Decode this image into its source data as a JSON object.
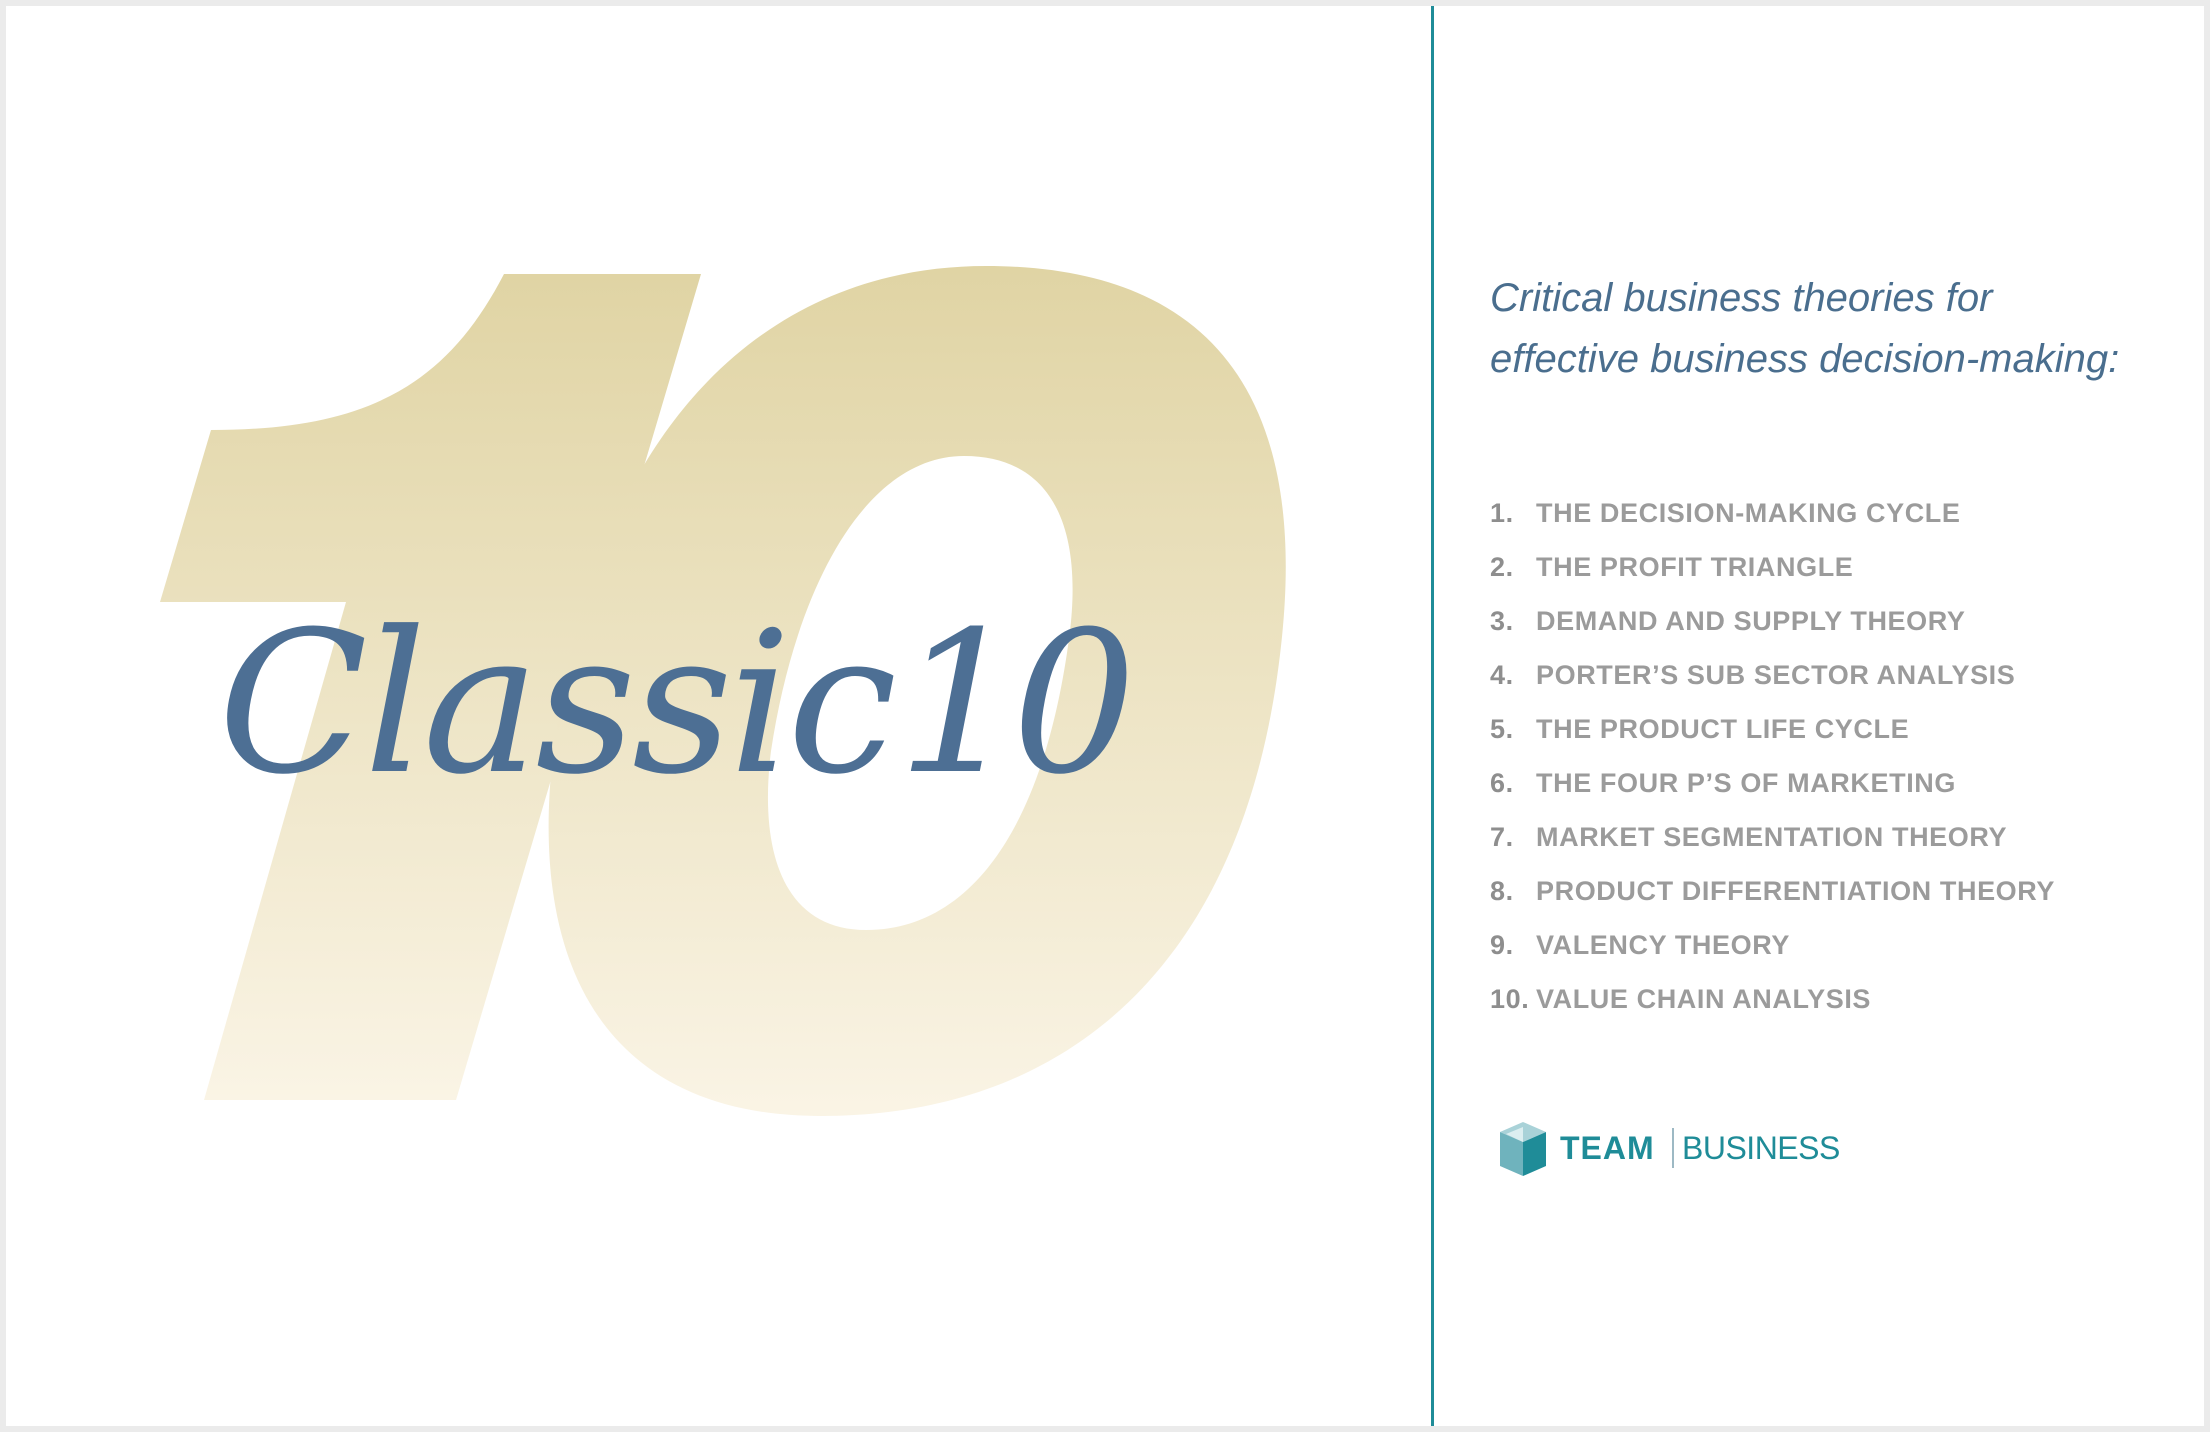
{
  "title": {
    "word": "Classic",
    "number": "10"
  },
  "tagline": "Critical business theories for effective business decision-making:",
  "theories": [
    {
      "num": "1.",
      "label": "THE DECISION-MAKING CYCLE"
    },
    {
      "num": "2.",
      "label": "THE PROFIT TRIANGLE"
    },
    {
      "num": "3.",
      "label": "DEMAND AND SUPPLY THEORY"
    },
    {
      "num": "4.",
      "label": "PORTER’S SUB SECTOR ANALYSIS"
    },
    {
      "num": "5.",
      "label": "THE PRODUCT LIFE CYCLE"
    },
    {
      "num": "6.",
      "label": "THE FOUR P’S OF MARKETING"
    },
    {
      "num": "7.",
      "label": "MARKET SEGMENTATION THEORY"
    },
    {
      "num": "8.",
      "label": "PRODUCT DIFFERENTIATION THEORY"
    },
    {
      "num": "9.",
      "label": "VALENCY THEORY"
    },
    {
      "num": "10.",
      "label": "VALUE CHAIN ANALYSIS"
    }
  ],
  "logo": {
    "team": "TEAM",
    "business": "BUSINESS",
    "icon": "cube-icon"
  },
  "colors": {
    "title": "#4d6f94",
    "tagline": "#4a6e8e",
    "list": "#9b9b9b",
    "accent": "#1f8c98",
    "gold_top": "#e2d6a8",
    "gold_bottom": "#faf4e4"
  }
}
